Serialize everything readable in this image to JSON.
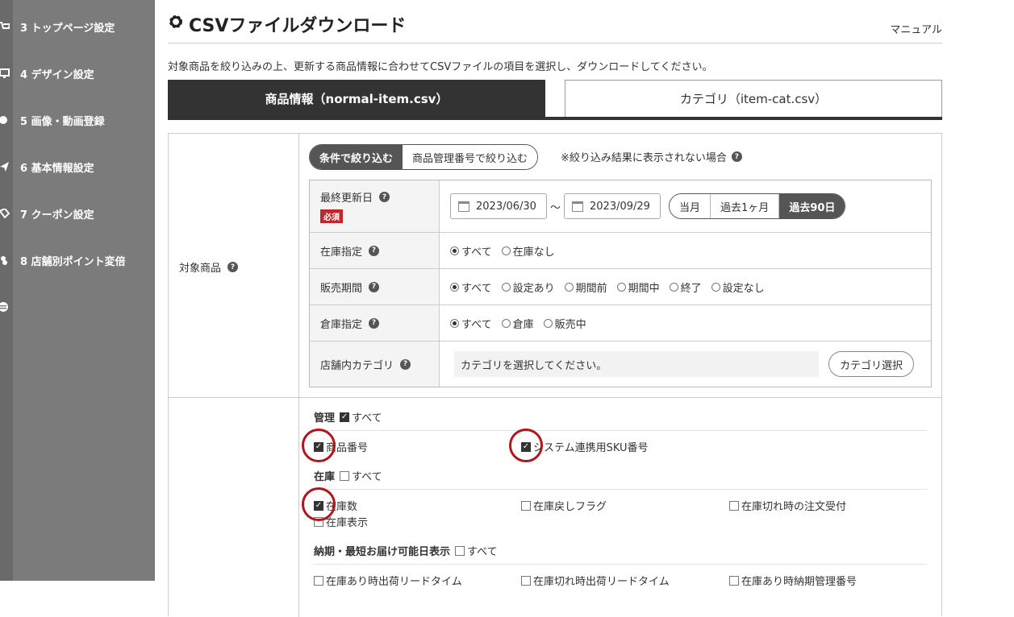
{
  "sidebar": {
    "items": [
      {
        "label": "3 トップページ設定",
        "icon": "cart-icon"
      },
      {
        "label": "4 デザイン設定",
        "icon": "monitor-icon"
      },
      {
        "label": "5 画像・動画登録",
        "icon": "image-icon"
      },
      {
        "label": "6 基本情報設定",
        "icon": "send-icon"
      },
      {
        "label": "7 クーポン設定",
        "icon": "coupon-icon"
      },
      {
        "label": "8 店舗別ポイント変倍",
        "icon": "points-icon"
      }
    ]
  },
  "header": {
    "title": "CSVファイルダウンロード",
    "manual_link": "マニュアル",
    "description": "対象商品を絞り込みの上、更新する商品情報に合わせてCSVファイルの項目を選択し、ダウンロードしてください。"
  },
  "tabs": [
    {
      "label": "商品情報（normal-item.csv）",
      "active": true
    },
    {
      "label": "カテゴリ（item-cat.csv）",
      "active": false
    }
  ],
  "target": {
    "label": "対象商品",
    "segment": [
      "条件で絞り込む",
      "商品管理番号で絞り込む"
    ],
    "note": "※絞り込み結果に表示されない場合",
    "filters": {
      "last_updated": {
        "label": "最終更新日",
        "required": "必須",
        "from": "2023/06/30",
        "sep": "〜",
        "to": "2023/09/29",
        "ranges": [
          "当月",
          "過去1ヶ月",
          "過去90日"
        ]
      },
      "stock": {
        "label": "在庫指定",
        "options": [
          "すべて",
          "在庫なし"
        ]
      },
      "sale_period": {
        "label": "販売期間",
        "options": [
          "すべて",
          "設定あり",
          "期間前",
          "期間中",
          "終了",
          "設定なし"
        ]
      },
      "warehouse": {
        "label": "倉庫指定",
        "options": [
          "すべて",
          "倉庫",
          "販売中"
        ]
      },
      "category": {
        "label": "店舗内カテゴリ",
        "placeholder": "カテゴリを選択してください。",
        "button": "カテゴリ選択"
      }
    }
  },
  "columns": {
    "mgmt": {
      "title": "管理",
      "all": "すべて",
      "items": [
        "商品番号",
        "システム連携用SKU番号"
      ]
    },
    "stock": {
      "title": "在庫",
      "all": "すべて",
      "items": [
        "在庫数",
        "在庫戻しフラグ",
        "在庫切れ時の注文受付",
        "在庫表示"
      ]
    },
    "delivery": {
      "title": "納期・最短お届け可能日表示",
      "all": "すべて",
      "items": [
        "在庫あり時出荷リードタイム",
        "在庫切れ時出荷リードタイム",
        "在庫あり時納期管理番号"
      ]
    }
  },
  "colors": {
    "accent": "#333333",
    "highlight_ring": "#b0171c",
    "required": "#c0282b",
    "sidebar": "#7b7b7b"
  }
}
